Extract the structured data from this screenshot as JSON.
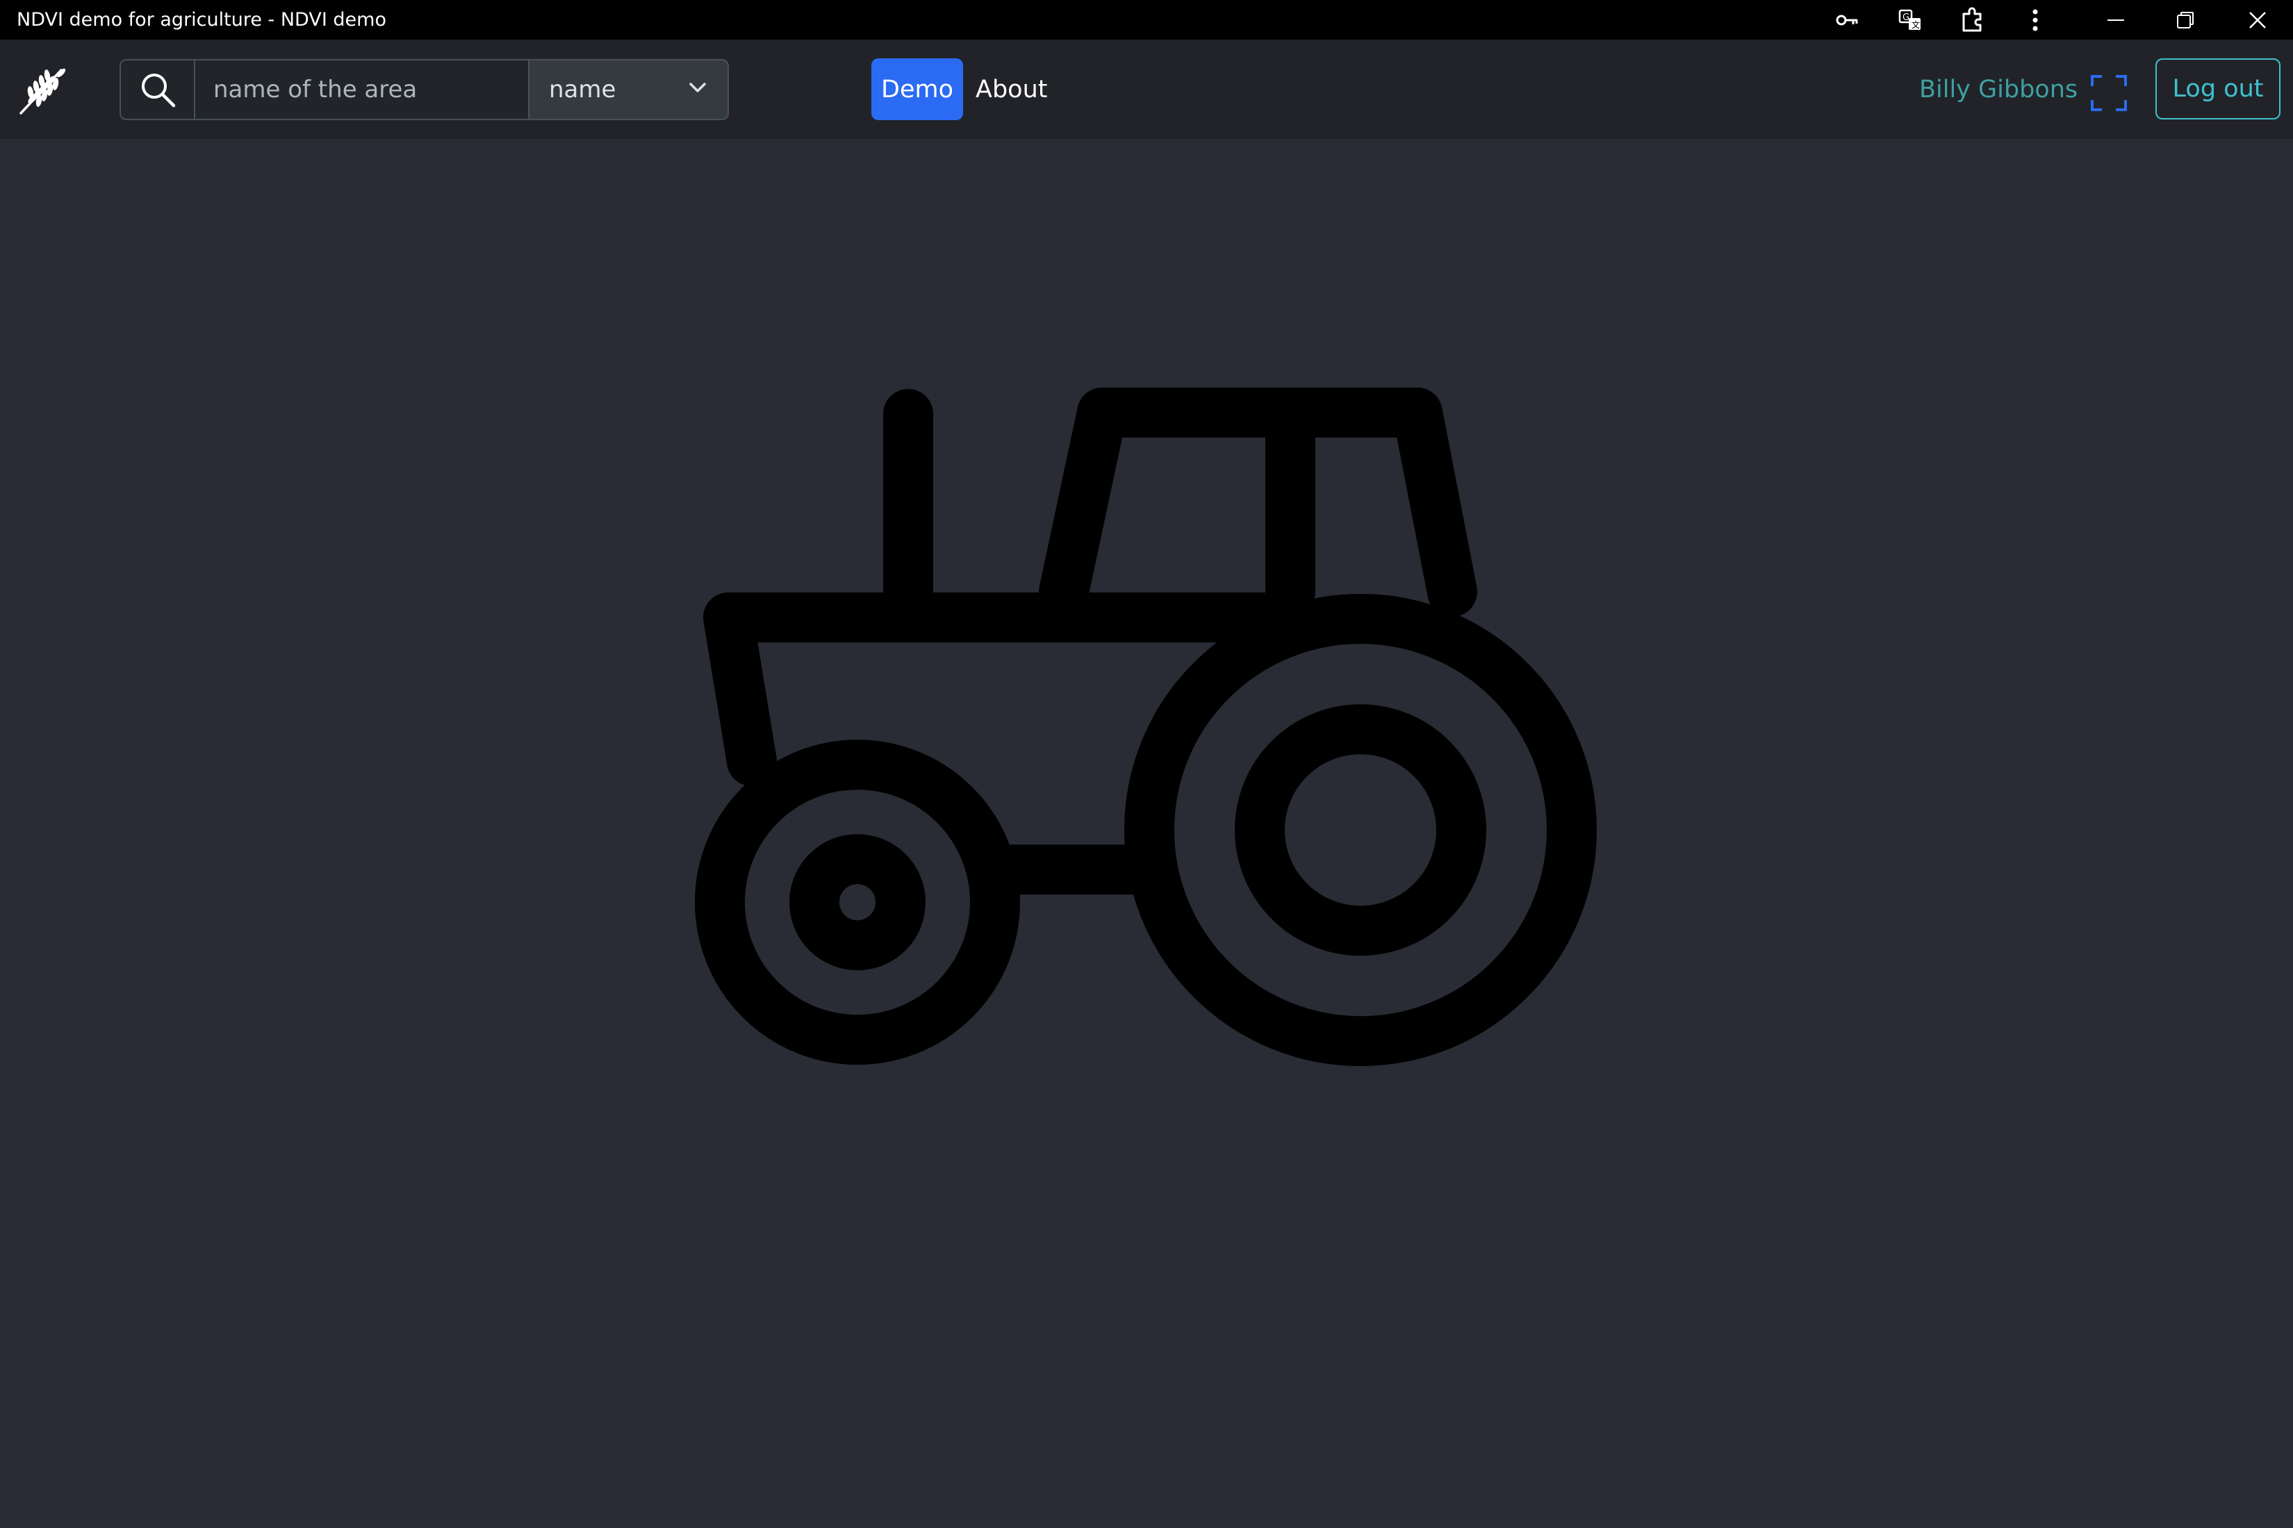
{
  "window": {
    "title": "NDVI demo for agriculture - NDVI demo",
    "icons": [
      "key-icon",
      "translate-icon",
      "extensions-icon",
      "more-vert-icon",
      "minimize-icon",
      "restore-icon",
      "close-icon"
    ]
  },
  "navbar": {
    "logo_icon": "wheat-icon",
    "search": {
      "icon": "search-icon",
      "placeholder": "name of the area",
      "value": ""
    },
    "select": {
      "selected": "name",
      "icon": "chevron-down-icon"
    },
    "links": {
      "demo": "Demo",
      "about": "About"
    },
    "active_link": "Demo",
    "user_name": "Billy Gibbons",
    "fullscreen_icon": "fullscreen-icon",
    "logout_label": "Log out"
  },
  "main": {
    "illustration_icon": "tractor-icon"
  },
  "colors": {
    "window_titlebar": "#000000",
    "navbar_bg": "#212328",
    "page_bg": "#292c35",
    "accent_blue": "#2b6bf3",
    "user_name": "#3ea0a3",
    "logout_outline": "#3fc1d0",
    "fullscreen_icon": "#2b6bf3",
    "illustration": "#000000"
  }
}
